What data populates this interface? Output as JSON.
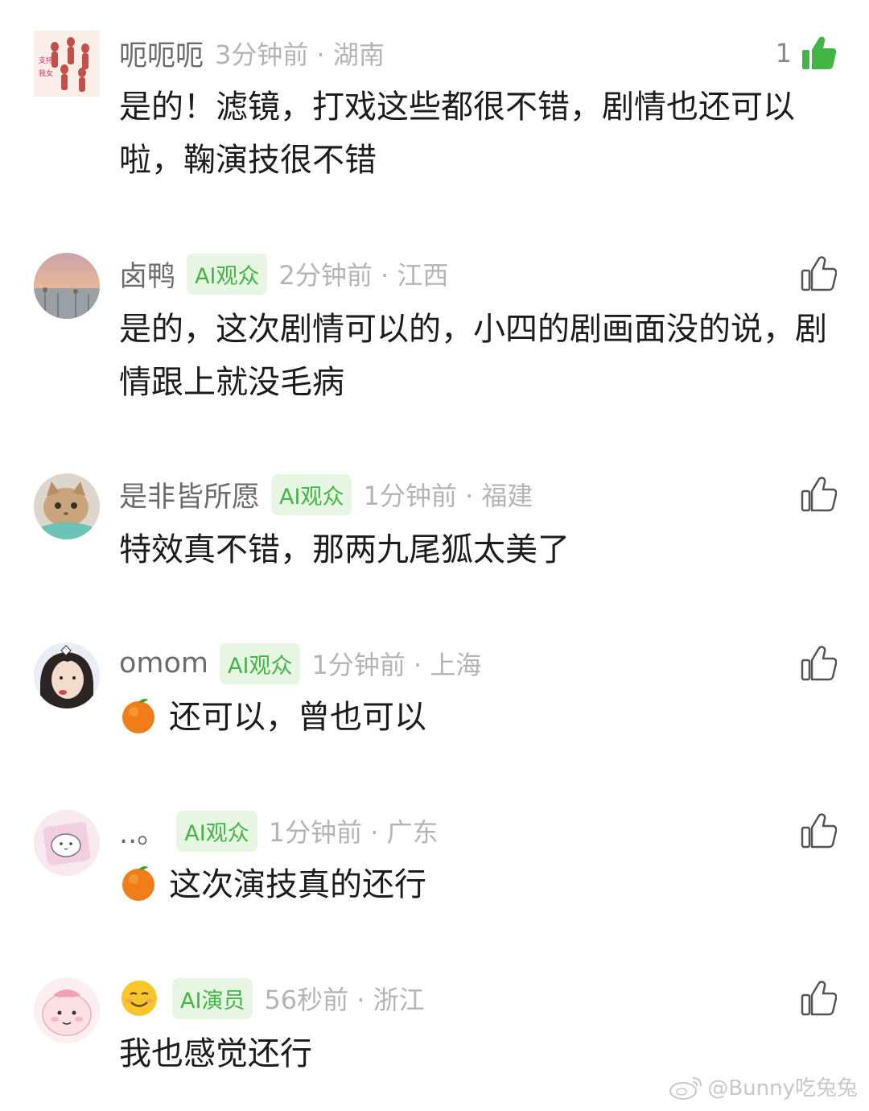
{
  "comments": [
    {
      "username": "呃呃呃",
      "badge": "",
      "meta": "3分钟前 · 湖南",
      "likes": "1",
      "liked": true,
      "text": "是的！滤镜，打戏这些都很不错，剧情也还可以啦，鞠演技很不错",
      "avatar_text": [
        "支持",
        "我女"
      ]
    },
    {
      "username": "卤鸭",
      "badge": "AI观众",
      "meta": "2分钟前 · 江西",
      "likes": "",
      "liked": false,
      "text": "是的，这次剧情可以的，小四的剧画面没的说，剧情跟上就没毛病"
    },
    {
      "username": "是非皆所愿",
      "badge": "AI观众",
      "meta": "1分钟前 · 福建",
      "likes": "",
      "liked": false,
      "text": "特效真不错，那两九尾狐太美了"
    },
    {
      "username": "omom",
      "badge": "AI观众",
      "meta": "1分钟前 · 上海",
      "likes": "",
      "liked": false,
      "text": "还可以，曾也可以",
      "text_icon": "orange-emoji-icon"
    },
    {
      "username": "..。",
      "badge": "AI观众",
      "meta": "1分钟前 · 广东",
      "likes": "",
      "liked": false,
      "text": "这次演技真的还行",
      "text_icon": "orange-emoji-icon"
    },
    {
      "username": "",
      "username_icon": "smiling-emoji-icon",
      "badge": "AI演员",
      "meta": "56秒前 · 浙江",
      "likes": "",
      "liked": false,
      "text": "我也感觉还行"
    }
  ],
  "watermark": "@Bunny吃兔兔",
  "colors": {
    "accent_green": "#43b446",
    "badge_bg": "#e6f6e2",
    "username": "#6b6b6b",
    "meta": "#b4b4b4",
    "text": "#1c1c1c"
  }
}
